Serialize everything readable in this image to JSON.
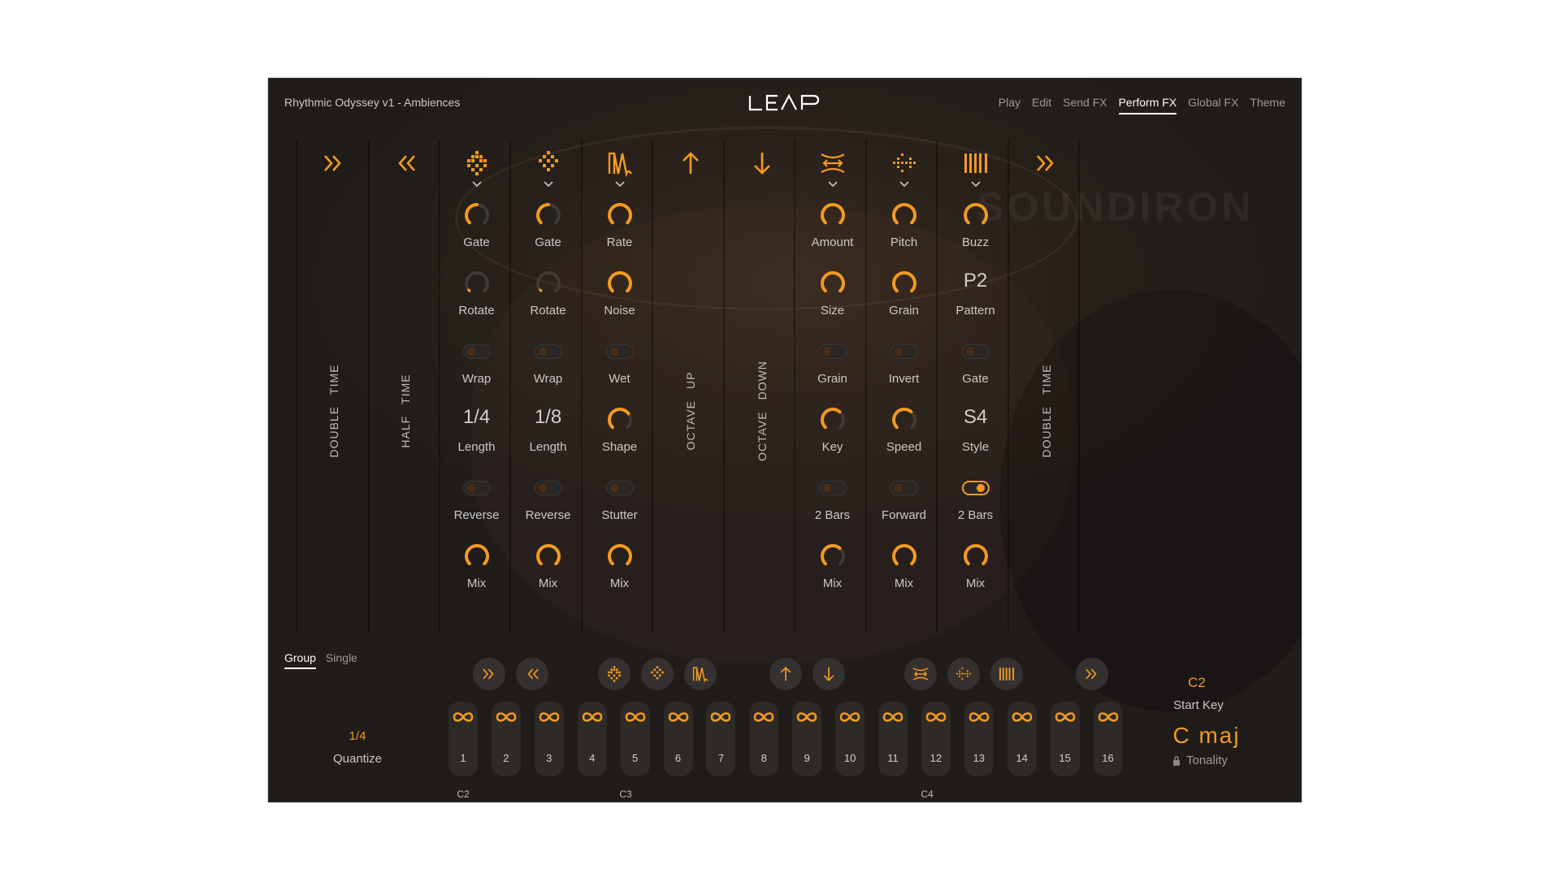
{
  "header": {
    "title": "Rhythmic Odyssey v1 - Ambiences",
    "logo_text": "LEAP",
    "tabs": [
      "Play",
      "Edit",
      "Send FX",
      "Perform FX",
      "Global FX",
      "Theme"
    ],
    "active_tab": "Perform FX"
  },
  "watermark": "SOUNDIRON",
  "fx_columns": [
    {
      "icon": "double-time-icon",
      "vertical_label": [
        "DOUBLE",
        "TIME"
      ]
    },
    {
      "icon": "half-time-icon",
      "vertical_label": [
        "HALF",
        "TIME"
      ]
    },
    {
      "icon": "glitch-icon",
      "dropdown": true,
      "rows": [
        {
          "type": "knob",
          "label": "Gate",
          "value": 0.5
        },
        {
          "type": "knob",
          "label": "Rotate",
          "value": 0.0
        },
        {
          "type": "toggle",
          "label": "Wrap",
          "on": false
        },
        {
          "type": "value",
          "label": "Length",
          "value": "1/4"
        },
        {
          "type": "toggle",
          "label": "Reverse",
          "on": false
        },
        {
          "type": "knob",
          "label": "Mix",
          "value": 1.0
        }
      ]
    },
    {
      "icon": "glitch-alt-icon",
      "dropdown": true,
      "rows": [
        {
          "type": "knob",
          "label": "Gate",
          "value": 0.5
        },
        {
          "type": "knob",
          "label": "Rotate",
          "value": 0.0
        },
        {
          "type": "toggle",
          "label": "Wrap",
          "on": false
        },
        {
          "type": "value",
          "label": "Length",
          "value": "1/8"
        },
        {
          "type": "toggle",
          "label": "Reverse",
          "on": false
        },
        {
          "type": "knob",
          "label": "Mix",
          "value": 1.0
        }
      ]
    },
    {
      "icon": "tape-stop-icon",
      "dropdown": true,
      "rows": [
        {
          "type": "knob",
          "label": "Rate",
          "value": 1.0
        },
        {
          "type": "knob",
          "label": "Noise",
          "value": 1.0
        },
        {
          "type": "toggle",
          "label": "Wet",
          "on": false
        },
        {
          "type": "knob",
          "label": "Shape",
          "value": 0.7
        },
        {
          "type": "toggle",
          "label": "Stutter",
          "on": false
        },
        {
          "type": "knob",
          "label": "Mix",
          "value": 1.0
        }
      ]
    },
    {
      "icon": "arrow-up-icon",
      "vertical_label": [
        "OCTAVE",
        "UP"
      ]
    },
    {
      "icon": "arrow-down-icon",
      "vertical_label": [
        "OCTAVE",
        "DOWN"
      ]
    },
    {
      "icon": "stretch-icon",
      "dropdown": true,
      "rows": [
        {
          "type": "knob",
          "label": "Amount",
          "value": 1.0
        },
        {
          "type": "knob",
          "label": "Size",
          "value": 1.0
        },
        {
          "type": "toggle",
          "label": "Grain",
          "on": false
        },
        {
          "type": "knob",
          "label": "Key",
          "value": 0.65
        },
        {
          "type": "toggle",
          "label": "2 Bars",
          "on": false
        },
        {
          "type": "knob",
          "label": "Mix",
          "value": 0.65
        }
      ]
    },
    {
      "icon": "granular-icon",
      "dropdown": true,
      "rows": [
        {
          "type": "knob",
          "label": "Pitch",
          "value": 1.0
        },
        {
          "type": "knob",
          "label": "Grain",
          "value": 1.0
        },
        {
          "type": "toggle",
          "label": "Invert",
          "on": false
        },
        {
          "type": "knob",
          "label": "Speed",
          "value": 0.65
        },
        {
          "type": "toggle",
          "label": "Forward",
          "on": false
        },
        {
          "type": "knob",
          "label": "Mix",
          "value": 1.0
        }
      ]
    },
    {
      "icon": "stutter-bars-icon",
      "dropdown": true,
      "rows": [
        {
          "type": "knob",
          "label": "Buzz",
          "value": 1.0
        },
        {
          "type": "value",
          "label": "Pattern",
          "value": "P2"
        },
        {
          "type": "toggle",
          "label": "Gate",
          "on": false
        },
        {
          "type": "value",
          "label": "Style",
          "value": "S4"
        },
        {
          "type": "toggle",
          "label": "2 Bars",
          "on": true
        },
        {
          "type": "knob",
          "label": "Mix",
          "value": 1.0
        }
      ]
    },
    {
      "icon": "double-time-icon",
      "vertical_label": [
        "DOUBLE",
        "TIME"
      ]
    }
  ],
  "footer": {
    "mode_tabs": [
      "Group",
      "Single"
    ],
    "active_mode": "Group",
    "quantize": {
      "value": "1/4",
      "label": "Quantize"
    },
    "fx_buttons": [
      "double-time-icon",
      "half-time-icon",
      "glitch-icon",
      "glitch-alt-icon",
      "tape-stop-icon",
      "arrow-up-icon",
      "arrow-down-icon",
      "stretch-icon",
      "granular-icon",
      "stutter-bars-icon",
      "double-time-icon"
    ],
    "pads": [
      "1",
      "2",
      "3",
      "4",
      "5",
      "6",
      "7",
      "8",
      "9",
      "10",
      "11",
      "12",
      "13",
      "14",
      "15",
      "16"
    ],
    "pad_icon": "infinity-icon",
    "notes": [
      "C2",
      "C3",
      "C4"
    ],
    "start_key": {
      "value": "C2",
      "label": "Start Key"
    },
    "tonality": {
      "value": "C  maj",
      "label": "Tonality",
      "icon": "lock-icon"
    }
  },
  "colors": {
    "accent": "#f39a1f",
    "panel": "#211e1c",
    "text": "#c9c9c9"
  }
}
